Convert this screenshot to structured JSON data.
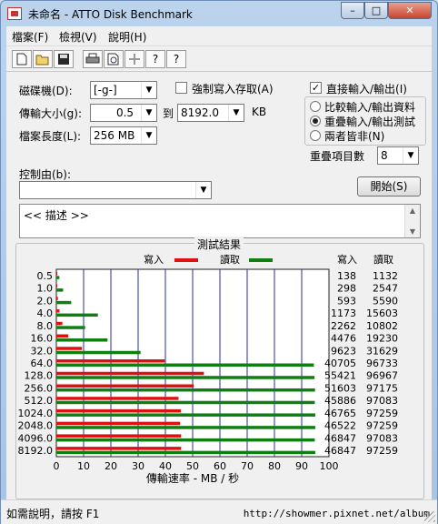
{
  "window": {
    "title": "未命名 - ATTO Disk Benchmark",
    "min_glyph": "–",
    "max_glyph": "□",
    "close_glyph": "✕"
  },
  "menu": [
    "檔案(F)",
    "檢視(V)",
    "說明(H)"
  ],
  "toolbar": {
    "help_glyph": "?",
    "context_help_glyph": "?"
  },
  "form": {
    "drive_label": "磁碟機(D):",
    "drive_value": "[-g-]",
    "force_write_label": "強制寫入存取(A)",
    "force_write_checked": false,
    "direct_io_label": "直接輸入/輸出(I)",
    "direct_io_checked": true,
    "transfer_label": "傳輸大小(g):",
    "transfer_from": "0.5",
    "to_label": "到",
    "transfer_to": "8192.0",
    "unit": "KB",
    "length_label": "檔案長度(L):",
    "length_value": "256 MB",
    "io_modes": [
      {
        "label": "比較輸入/輸出資料",
        "selected": false
      },
      {
        "label": "重疊輸入/輸出測試",
        "selected": true
      },
      {
        "label": "兩者皆非(N)",
        "selected": false
      }
    ],
    "queue_label": "重疊項目數",
    "queue_value": "8",
    "controlled_by_label": "控制由(b):",
    "controlled_by_value": "",
    "start_label": "開始(S)",
    "description": "<< 描述 >>",
    "check_glyph": "✓",
    "dropdown_glyph": "▼",
    "scroll_up_glyph": "▲",
    "scroll_down_glyph": "▼"
  },
  "results": {
    "title": "測試結果",
    "write_label": "寫入",
    "read_label": "讀取"
  },
  "chart_data": {
    "type": "bar",
    "orientation": "horizontal",
    "categories": [
      "0.5",
      "1.0",
      "2.0",
      "4.0",
      "8.0",
      "16.0",
      "32.0",
      "64.0",
      "128.0",
      "256.0",
      "512.0",
      "1024.0",
      "2048.0",
      "4096.0",
      "8192.0"
    ],
    "series": [
      {
        "name": "寫入",
        "color": "#e01010",
        "values": [
          138,
          298,
          593,
          1173,
          2262,
          4476,
          9623,
          40705,
          55421,
          51603,
          45886,
          46765,
          46522,
          46847,
          46847
        ]
      },
      {
        "name": "讀取",
        "color": "#0f7f12",
        "values": [
          1132,
          2547,
          5590,
          15603,
          10802,
          19230,
          31629,
          96733,
          96967,
          97175,
          97083,
          97259,
          97259,
          97083,
          97259
        ]
      }
    ],
    "xlabel": "傳輸速率 - MB / 秒",
    "xlim": [
      0,
      100
    ],
    "xticks": [
      0,
      10,
      20,
      30,
      40,
      50,
      60,
      70,
      80,
      90,
      100
    ],
    "grid": true,
    "value_units": "KB/s"
  },
  "status": {
    "text": "如需說明，請按 F1",
    "watermark": "http://showmer.pixnet.net/album"
  }
}
